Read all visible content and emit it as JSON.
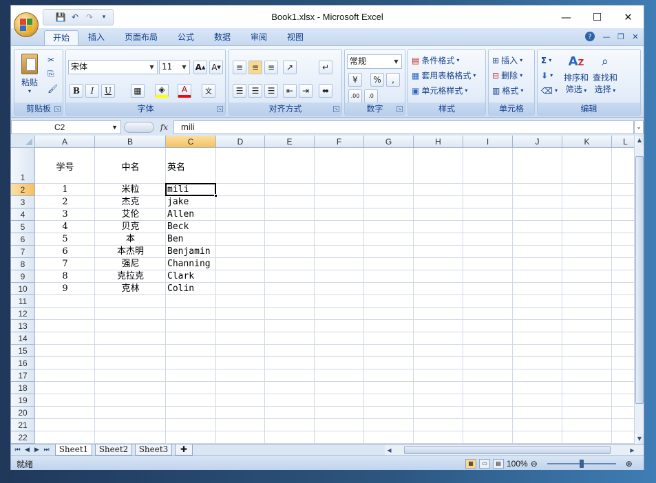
{
  "window": {
    "title": "Book1.xlsx - Microsoft Excel",
    "controls": {
      "minimize": "—",
      "maximize": "☐",
      "close": "✕"
    }
  },
  "ribbon_tabs": [
    {
      "label": "开始",
      "active": true
    },
    {
      "label": "插入"
    },
    {
      "label": "页面布局"
    },
    {
      "label": "公式"
    },
    {
      "label": "数据"
    },
    {
      "label": "审阅"
    },
    {
      "label": "视图"
    }
  ],
  "ribbon_groups": {
    "clipboard": {
      "label": "剪贴板",
      "paste": "粘贴"
    },
    "font": {
      "label": "字体",
      "font_name": "宋体",
      "font_size": "11"
    },
    "alignment": {
      "label": "对齐方式"
    },
    "number": {
      "label": "数字",
      "format": "常规"
    },
    "styles": {
      "label": "样式",
      "conditional": "条件格式",
      "table": "套用表格格式",
      "cell": "单元格样式"
    },
    "cells": {
      "label": "单元格",
      "insert": "插入",
      "delete": "删除",
      "format": "格式"
    },
    "editing": {
      "label": "编辑",
      "sort": "排序和",
      "filter": "筛选",
      "find": "查找和",
      "select": "选择"
    }
  },
  "formula_bar": {
    "name_box": "C2",
    "fx": "fx",
    "content": "mili"
  },
  "sheet": {
    "columns": [
      "A",
      "B",
      "C",
      "D",
      "E",
      "F",
      "G",
      "H",
      "I",
      "J",
      "K",
      "L"
    ],
    "row_numbers": [
      "1",
      "2",
      "3",
      "4",
      "5",
      "6",
      "7",
      "8",
      "9",
      "10",
      "11",
      "12",
      "13",
      "14",
      "15",
      "16",
      "17",
      "18",
      "19",
      "20",
      "21",
      "22"
    ],
    "header": {
      "a": "学号",
      "b": "中名",
      "c": "英名"
    },
    "rows": [
      {
        "a": "1",
        "b": "米粒",
        "c": "mili"
      },
      {
        "a": "2",
        "b": "杰克",
        "c": "jake"
      },
      {
        "a": "3",
        "b": "艾伦",
        "c": "Allen"
      },
      {
        "a": "4",
        "b": "贝克",
        "c": "Beck"
      },
      {
        "a": "5",
        "b": "本",
        "c": "Ben"
      },
      {
        "a": "6",
        "b": "本杰明",
        "c": "Benjamin"
      },
      {
        "a": "7",
        "b": "强尼",
        "c": "Channing"
      },
      {
        "a": "8",
        "b": "克拉克",
        "c": "Clark"
      },
      {
        "a": "9",
        "b": "克林",
        "c": "Colin"
      }
    ],
    "active_cell": "C2"
  },
  "sheet_tabs": [
    "Sheet1",
    "Sheet2",
    "Sheet3"
  ],
  "status": {
    "text": "就绪",
    "zoom": "100%"
  },
  "colors": {
    "accent": "#15428b",
    "selected_header": "#f7c05e",
    "grid_line": "#d0d7e5"
  }
}
